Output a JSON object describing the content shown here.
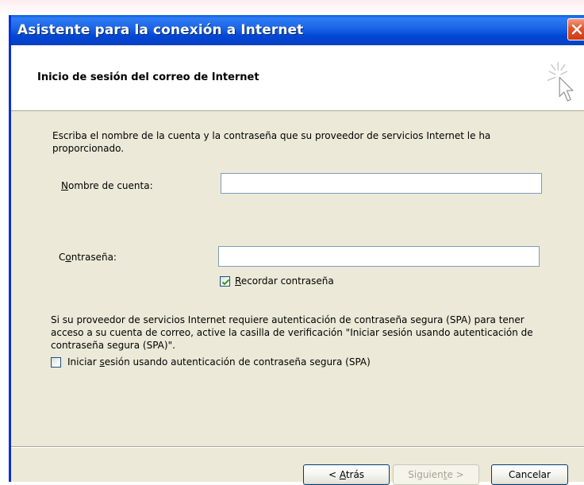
{
  "window": {
    "title": "Asistente para la conexión a Internet"
  },
  "header": {
    "title": "Inicio de sesión del correo de Internet",
    "icon": "wizard-pointer-sparkle-icon"
  },
  "form": {
    "intro": "Escriba el nombre de la cuenta y la contraseña que su proveedor de servicios Internet le ha proporcionado.",
    "account_label_prefix": "",
    "account_label_mnemonic": "N",
    "account_label_rest": "ombre de cuenta:",
    "account_value": "",
    "password_label_prefix": "C",
    "password_label_mnemonic": "o",
    "password_label_rest": "ntraseña:",
    "password_value": "",
    "remember_mnemonic": "R",
    "remember_rest": "ecordar contraseña",
    "remember_checked": true,
    "spa_info": "Si su proveedor de servicios Internet requiere autenticación de contraseña segura (SPA) para tener acceso a su cuenta de correo, active la casilla de verificación \"Iniciar sesión usando autenticación de contraseña segura (SPA)\".",
    "spa_label_prefix": "Iniciar ",
    "spa_label_mnemonic": "s",
    "spa_label_rest": "esión usando autenticación de contraseña segura (SPA)",
    "spa_checked": false
  },
  "buttons": {
    "back_prefix": "< ",
    "back_mnemonic": "A",
    "back_rest": "trás",
    "next_prefix": "Siguien",
    "next_mnemonic": "t",
    "next_rest": "e >",
    "cancel": "Cancelar"
  },
  "colors": {
    "titlebar": "#0a5ce0",
    "window_face": "#ece9d8",
    "close_button": "#e2552f",
    "checkbox_check": "#21a121"
  }
}
